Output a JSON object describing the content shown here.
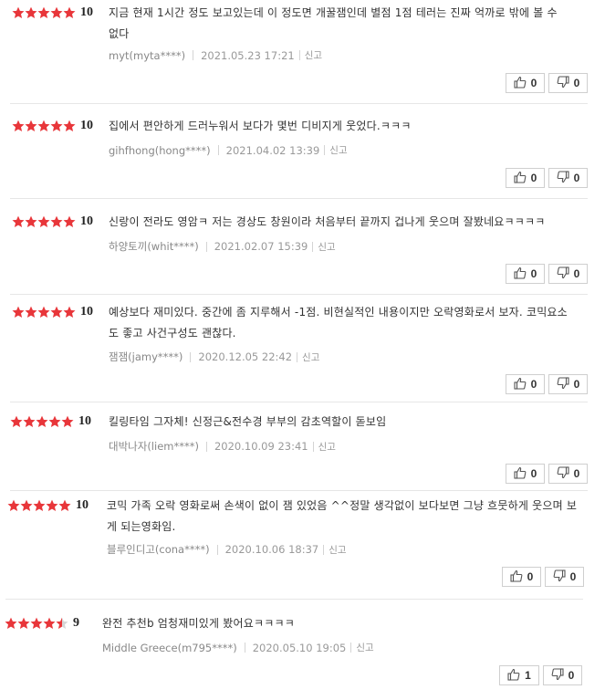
{
  "colors": {
    "star": "#e8363a",
    "star_empty": "#d6d6d6"
  },
  "report_label": "신고",
  "reviews": [
    {
      "score": "10",
      "rating": 5,
      "text": "지금 현재 1시간 정도 보고있는데 이 정도면 개꿀잼인데 별점 1점 테러는 진짜 억까로 밖에 볼 수 없다",
      "user": "myt(myta****)",
      "date": "2021.05.23 17:21",
      "likes": "0",
      "dislikes": "0"
    },
    {
      "score": "10",
      "rating": 5,
      "text": "집에서 편안하게 드러누워서 보다가 몇번 디비지게 웃었다.ㅋㅋㅋ",
      "user": "gihfhong(hong****)",
      "date": "2021.04.02 13:39",
      "likes": "0",
      "dislikes": "0"
    },
    {
      "score": "10",
      "rating": 5,
      "text": "신랑이 전라도 영암ㅋ 저는 경상도 창원이라 처음부터 끝까지 겁나게 웃으며 잘봤네요ㅋㅋㅋㅋ",
      "user": "하양토끼(whit****)",
      "date": "2021.02.07 15:39",
      "likes": "0",
      "dislikes": "0"
    },
    {
      "score": "10",
      "rating": 5,
      "text": "예상보다 재미있다. 중간에 좀 지루해서 -1점. 비현실적인 내용이지만 오락영화로서 보자. 코믹요소도 좋고 사건구성도 괜찮다.",
      "user": "잼잼(jamy****)",
      "date": "2020.12.05 22:42",
      "likes": "0",
      "dislikes": "0"
    },
    {
      "score": "10",
      "rating": 5,
      "text": "킬링타임 그자체! 신정근&전수경 부부의 감초역할이 돋보임",
      "user": "대박나자(liem****)",
      "date": "2020.10.09 23:41",
      "likes": "0",
      "dislikes": "0"
    },
    {
      "score": "10",
      "rating": 5,
      "text": "코믹 가족 오락 영화로써 손색이 없이 잼 있었음 ^^정말 생각없이 보다보면 그냥 흐뭇하게 웃으며 보게 되는영화임.",
      "user": "블루인디고(cona****)",
      "date": "2020.10.06 18:37",
      "likes": "0",
      "dislikes": "0"
    },
    {
      "score": "9",
      "rating": 4.5,
      "text": "완전 추천b 엄청재미있게 봤어요ㅋㅋㅋㅋ",
      "user": "Middle Greece(m795****)",
      "date": "2020.05.10 19:05",
      "likes": "1",
      "dislikes": "0"
    }
  ]
}
